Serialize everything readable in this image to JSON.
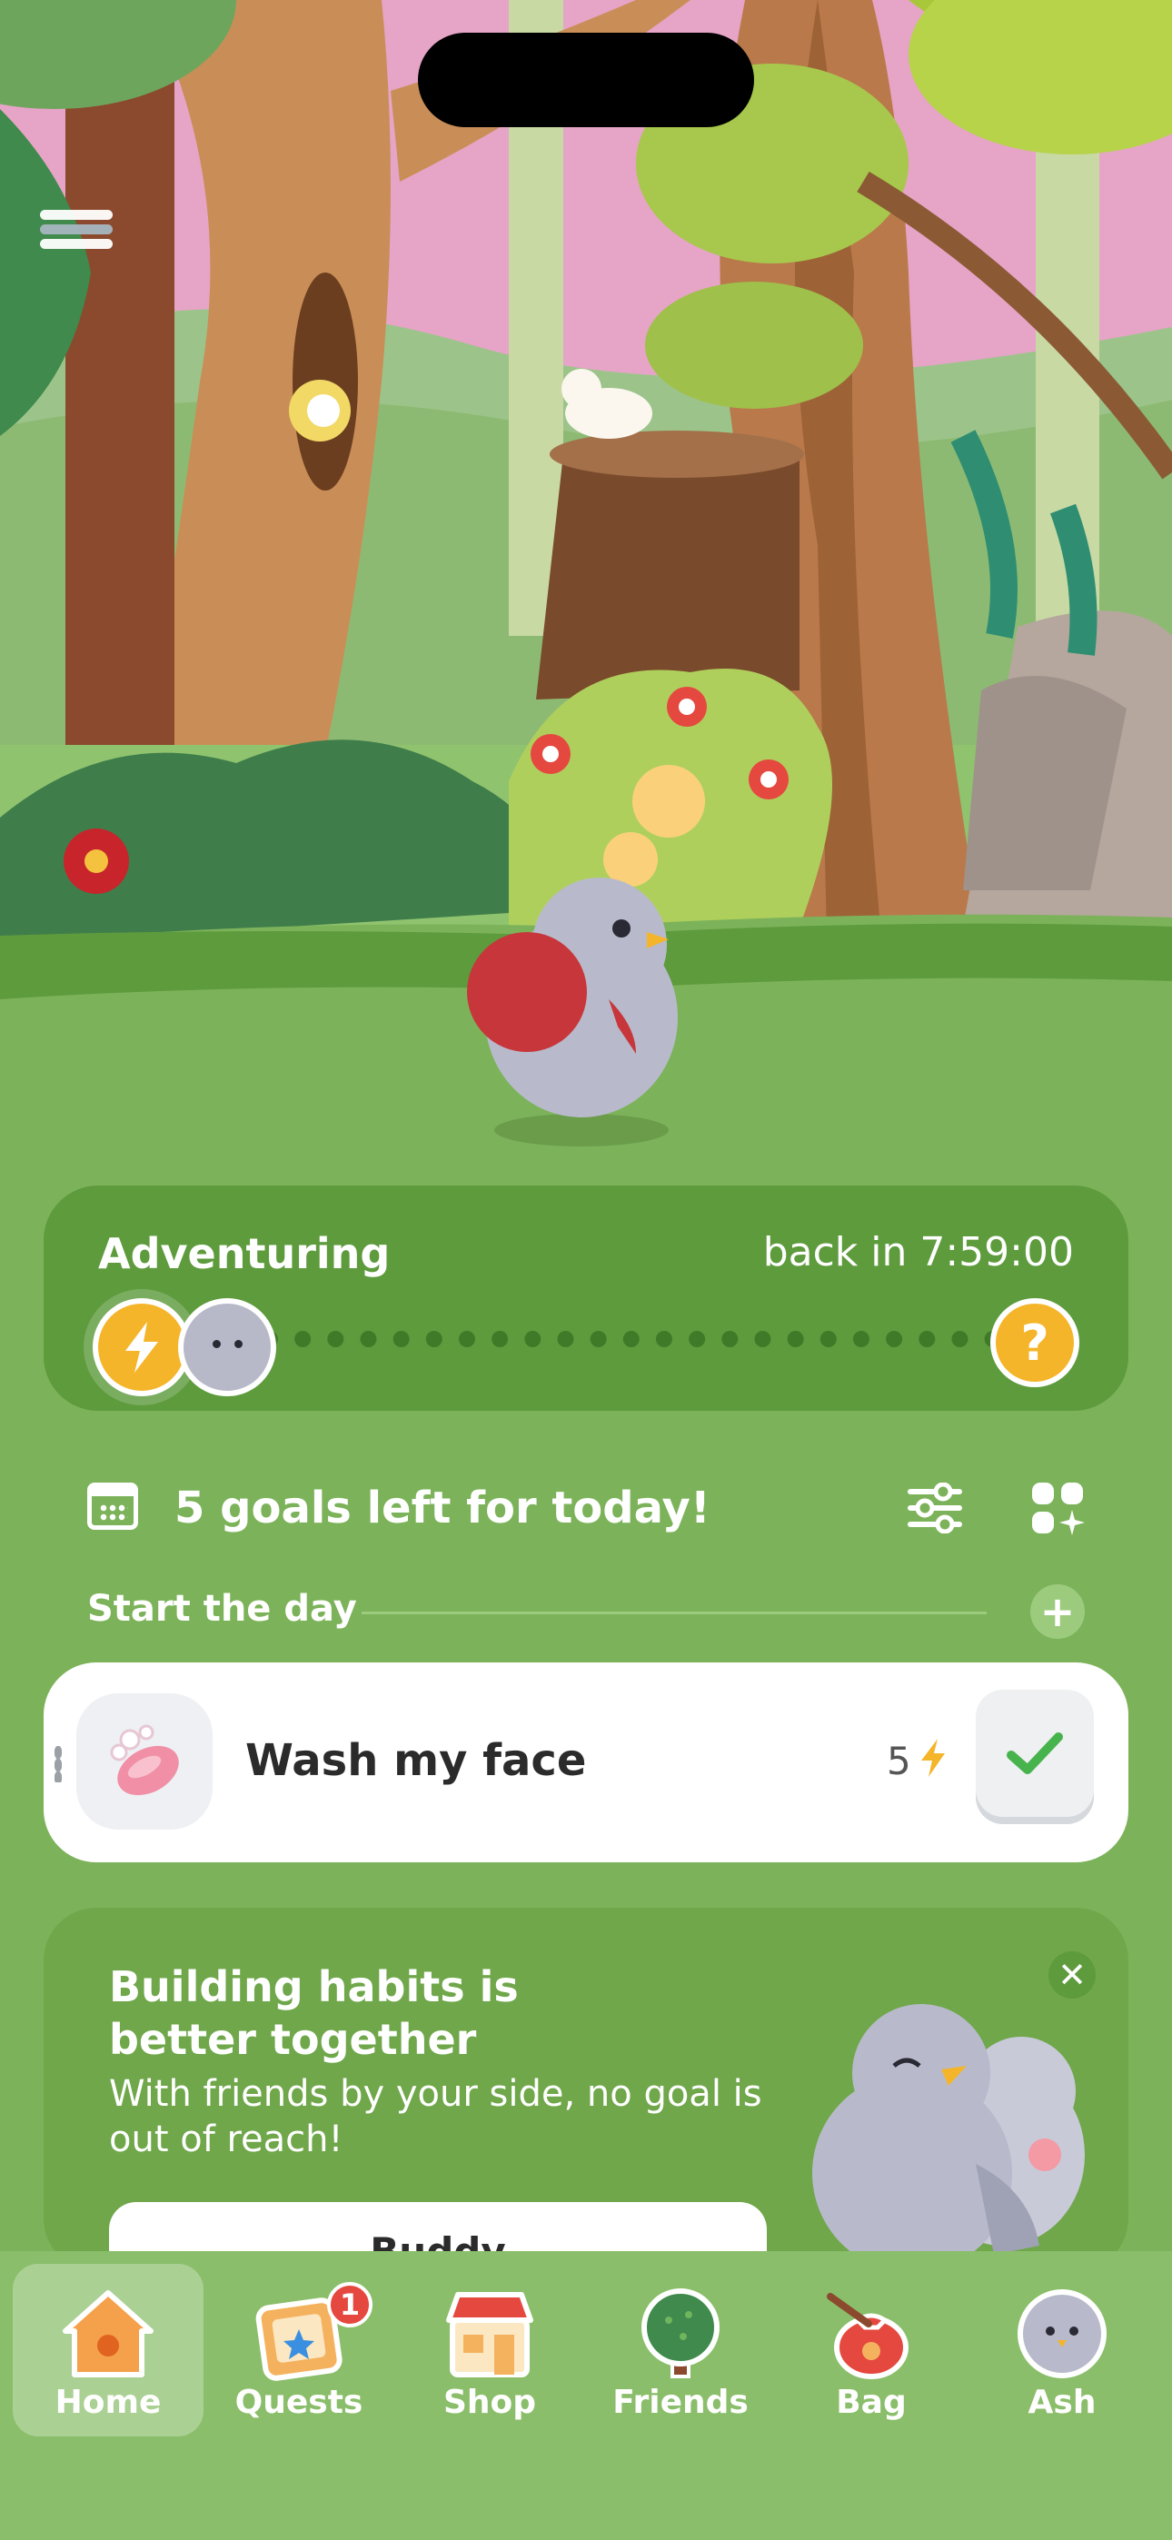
{
  "status": {
    "notch": "dynamic-island"
  },
  "header": {
    "menu_icon": "hamburger-menu-icon"
  },
  "adventure": {
    "title": "Adventuring",
    "timer": "back in 7:59:00",
    "help_glyph": "?"
  },
  "goals": {
    "summary": "5 goals left for today!"
  },
  "section": {
    "label": "Start the day",
    "add_glyph": "+"
  },
  "habit": {
    "title": "Wash my face",
    "points": "5"
  },
  "promo": {
    "title": "Building habits is better together",
    "body": "With friends by your side, no goal is out of reach!",
    "close_glyph": "✕",
    "button_label": "Buddy"
  },
  "tabbar": {
    "items": [
      {
        "label": "Home",
        "icon": "house-icon",
        "active": true
      },
      {
        "label": "Quests",
        "icon": "quest-board-icon",
        "badge": "1"
      },
      {
        "label": "Shop",
        "icon": "shop-icon"
      },
      {
        "label": "Friends",
        "icon": "tree-icon"
      },
      {
        "label": "Bag",
        "icon": "bag-icon"
      },
      {
        "label": "Ash",
        "icon": "bird-avatar-icon"
      }
    ]
  },
  "colors": {
    "background": "#7CB35A",
    "panel": "#5E9B3D",
    "accent": "#F4B52A",
    "badge": "#E5483F"
  }
}
